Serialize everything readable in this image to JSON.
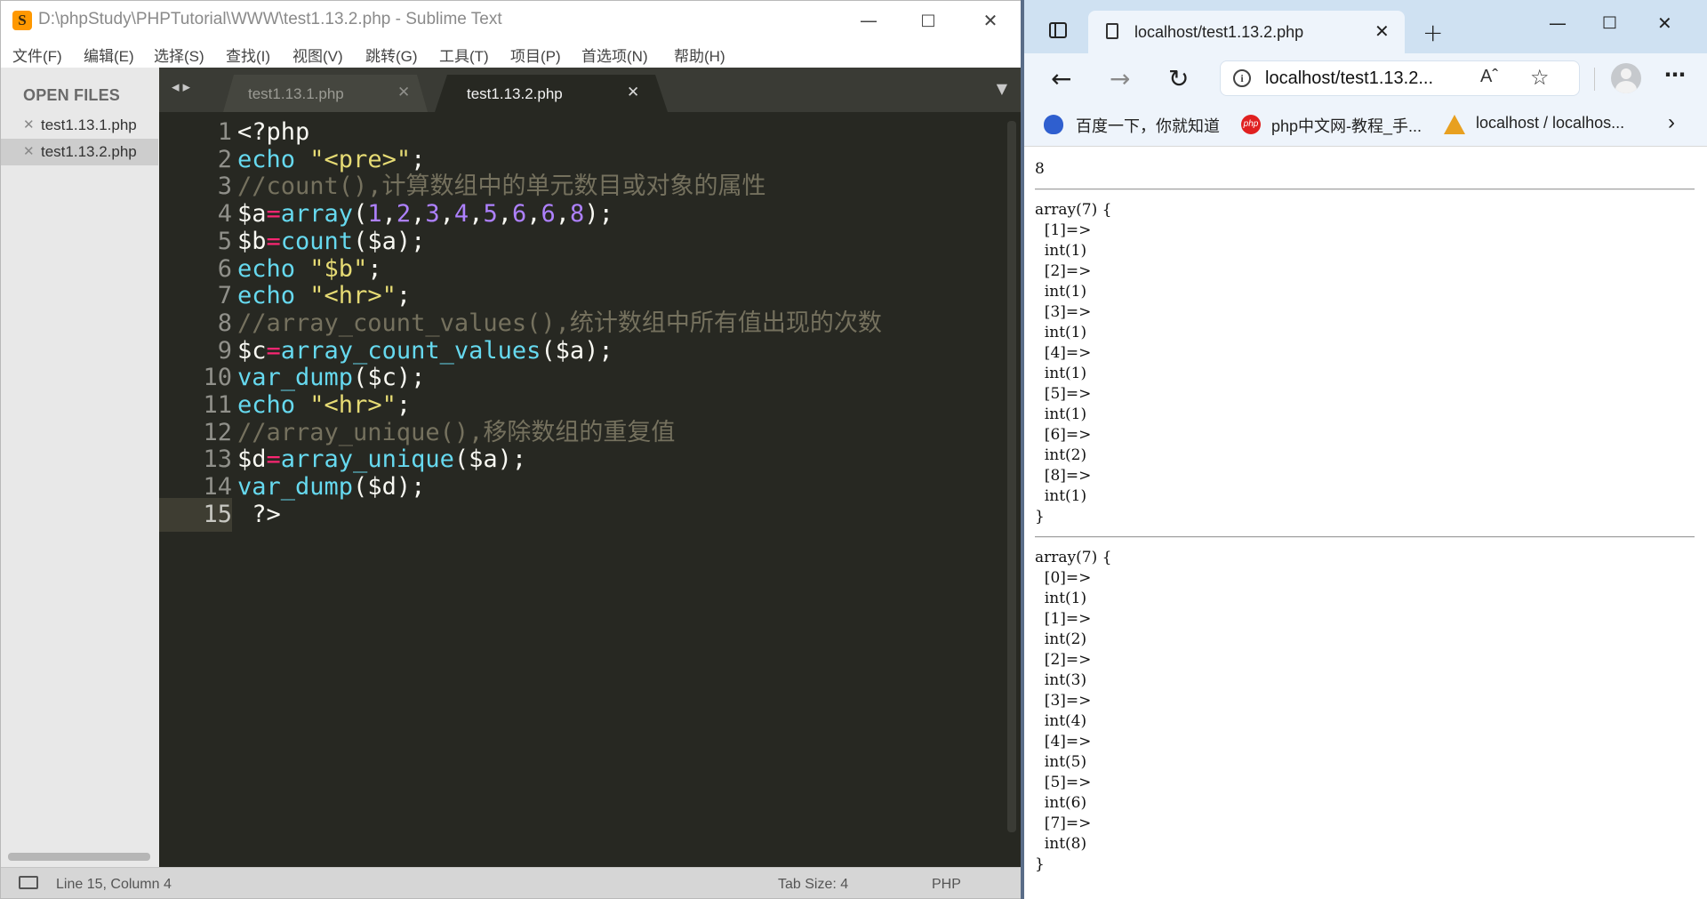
{
  "sublime": {
    "title": "D:\\phpStudy\\PHPTutorial\\WWW\\test1.13.2.php - Sublime Text",
    "logo": "S",
    "menu": [
      "文件(F)",
      "编辑(E)",
      "选择(S)",
      "查找(I)",
      "视图(V)",
      "跳转(G)",
      "工具(T)",
      "项目(P)",
      "首选项(N)",
      "帮助(H)"
    ],
    "sidebar": {
      "heading": "OPEN FILES",
      "files": [
        {
          "name": "test1.13.1.php",
          "active": false
        },
        {
          "name": "test1.13.2.php",
          "active": true
        }
      ]
    },
    "tabs": [
      {
        "label": "test1.13.1.php",
        "active": false
      },
      {
        "label": "test1.13.2.php",
        "active": true
      }
    ],
    "code_lines": [
      "<?php",
      "echo \"<pre>\";",
      "//count(),计算数组中的单元数目或对象的属性",
      "$a=array(1,2,3,4,5,6,6,8);",
      "$b=count($a);",
      "echo \"$b\";",
      "echo \"<hr>\";",
      "//array_count_values(),统计数组中所有值出现的次数",
      "$c=array_count_values($a);",
      "var_dump($c);",
      "echo \"<hr>\";",
      "//array_unique(),移除数组的重复值",
      "$d=array_unique($a);",
      "var_dump($d);",
      " ?>"
    ],
    "current_line": 15,
    "status": {
      "position": "Line 15, Column 4",
      "tab_size": "Tab Size: 4",
      "syntax": "PHP"
    },
    "colors": {
      "background": "#272822",
      "keyword": "#66d9ef",
      "string": "#e6db74",
      "comment": "#75715e",
      "number": "#ae81ff",
      "operator": "#f92672"
    }
  },
  "browser": {
    "tab_title": "localhost/test1.13.2.php",
    "address": "localhost/test1.13.2...",
    "read_aloud": "A̅̀",
    "bookmarks": [
      "百度一下，你就知道",
      "php中文网-教程_手...",
      "localhost / localhos..."
    ],
    "output": {
      "count": "8",
      "dump1": "array(7) {\n  [1]=>\n  int(1)\n  [2]=>\n  int(1)\n  [3]=>\n  int(1)\n  [4]=>\n  int(1)\n  [5]=>\n  int(1)\n  [6]=>\n  int(2)\n  [8]=>\n  int(1)\n}",
      "dump2": "array(7) {\n  [0]=>\n  int(1)\n  [1]=>\n  int(2)\n  [2]=>\n  int(3)\n  [3]=>\n  int(4)\n  [4]=>\n  int(5)\n  [5]=>\n  int(6)\n  [7]=>\n  int(8)\n}"
    }
  }
}
